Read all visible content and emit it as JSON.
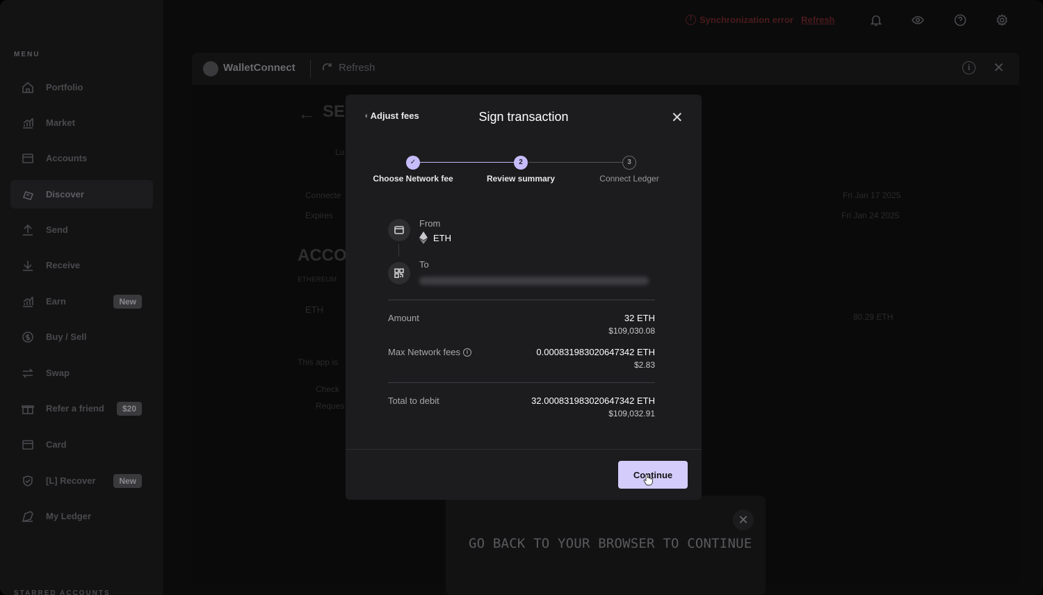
{
  "sidebar": {
    "heading": "MENU",
    "items": [
      {
        "label": "Portfolio",
        "icon": "home-icon"
      },
      {
        "label": "Market",
        "icon": "market-icon"
      },
      {
        "label": "Accounts",
        "icon": "wallet-icon"
      },
      {
        "label": "Discover",
        "icon": "discover-icon",
        "active": true
      },
      {
        "label": "Send",
        "icon": "send-icon"
      },
      {
        "label": "Receive",
        "icon": "receive-icon"
      },
      {
        "label": "Earn",
        "icon": "earn-icon",
        "badge": "New"
      },
      {
        "label": "Buy / Sell",
        "icon": "dollar-icon"
      },
      {
        "label": "Swap",
        "icon": "swap-icon"
      },
      {
        "label": "Refer a friend",
        "icon": "gift-icon",
        "badge": "$20"
      },
      {
        "label": "Card",
        "icon": "card-icon"
      },
      {
        "label": "[L] Recover",
        "icon": "shield-icon",
        "badge": "New"
      },
      {
        "label": "My Ledger",
        "icon": "ledger-icon"
      }
    ],
    "starred": "STARRED ACCOUNTS"
  },
  "topbar": {
    "error_text": "Synchronization error",
    "refresh_link": "Refresh"
  },
  "app": {
    "title": "WalletConnect",
    "refresh_label": "Refresh",
    "bg_heading_send": "SE",
    "bg_heading_accounts": "ACCOU",
    "bg_name": "Lu",
    "bg_connected": "Connecte",
    "bg_expires": "Expires",
    "bg_date1": "Fri Jan 17 2025",
    "bg_date2": "Fri Jan 24 2025",
    "bg_network": "ETHEREUM",
    "bg_eth": "ETH",
    "bg_balance": "80.29 ETH",
    "bg_app_text": "This app is",
    "bg_check": "Check",
    "bg_request": "Reques"
  },
  "toast": {
    "text": "GO BACK TO YOUR BROWSER TO CONTINUE"
  },
  "modal": {
    "back_label": "Adjust fees",
    "title": "Sign transaction",
    "steps": [
      {
        "label": "Choose Network fee",
        "state": "done",
        "marker": "✓"
      },
      {
        "label": "Review summary",
        "state": "current",
        "marker": "2"
      },
      {
        "label": "Connect Ledger",
        "state": "todo",
        "marker": "3"
      }
    ],
    "from_label": "From",
    "from_value": "ETH",
    "to_label": "To",
    "amount_label": "Amount",
    "amount_value": "32 ETH",
    "amount_fiat": "$109,030.08",
    "fees_label": "Max Network fees",
    "fees_value": "0.000831983020647342 ETH",
    "fees_fiat": "$2.83",
    "total_label": "Total to debit",
    "total_value": "32.000831983020647342 ETH",
    "total_fiat": "$109,032.91",
    "continue_label": "Continue"
  },
  "colors": {
    "accent": "#d4cdfb",
    "step_accent": "#c6bcfb",
    "modal_bg": "#1c1c1e",
    "error": "#4a1a1c"
  }
}
